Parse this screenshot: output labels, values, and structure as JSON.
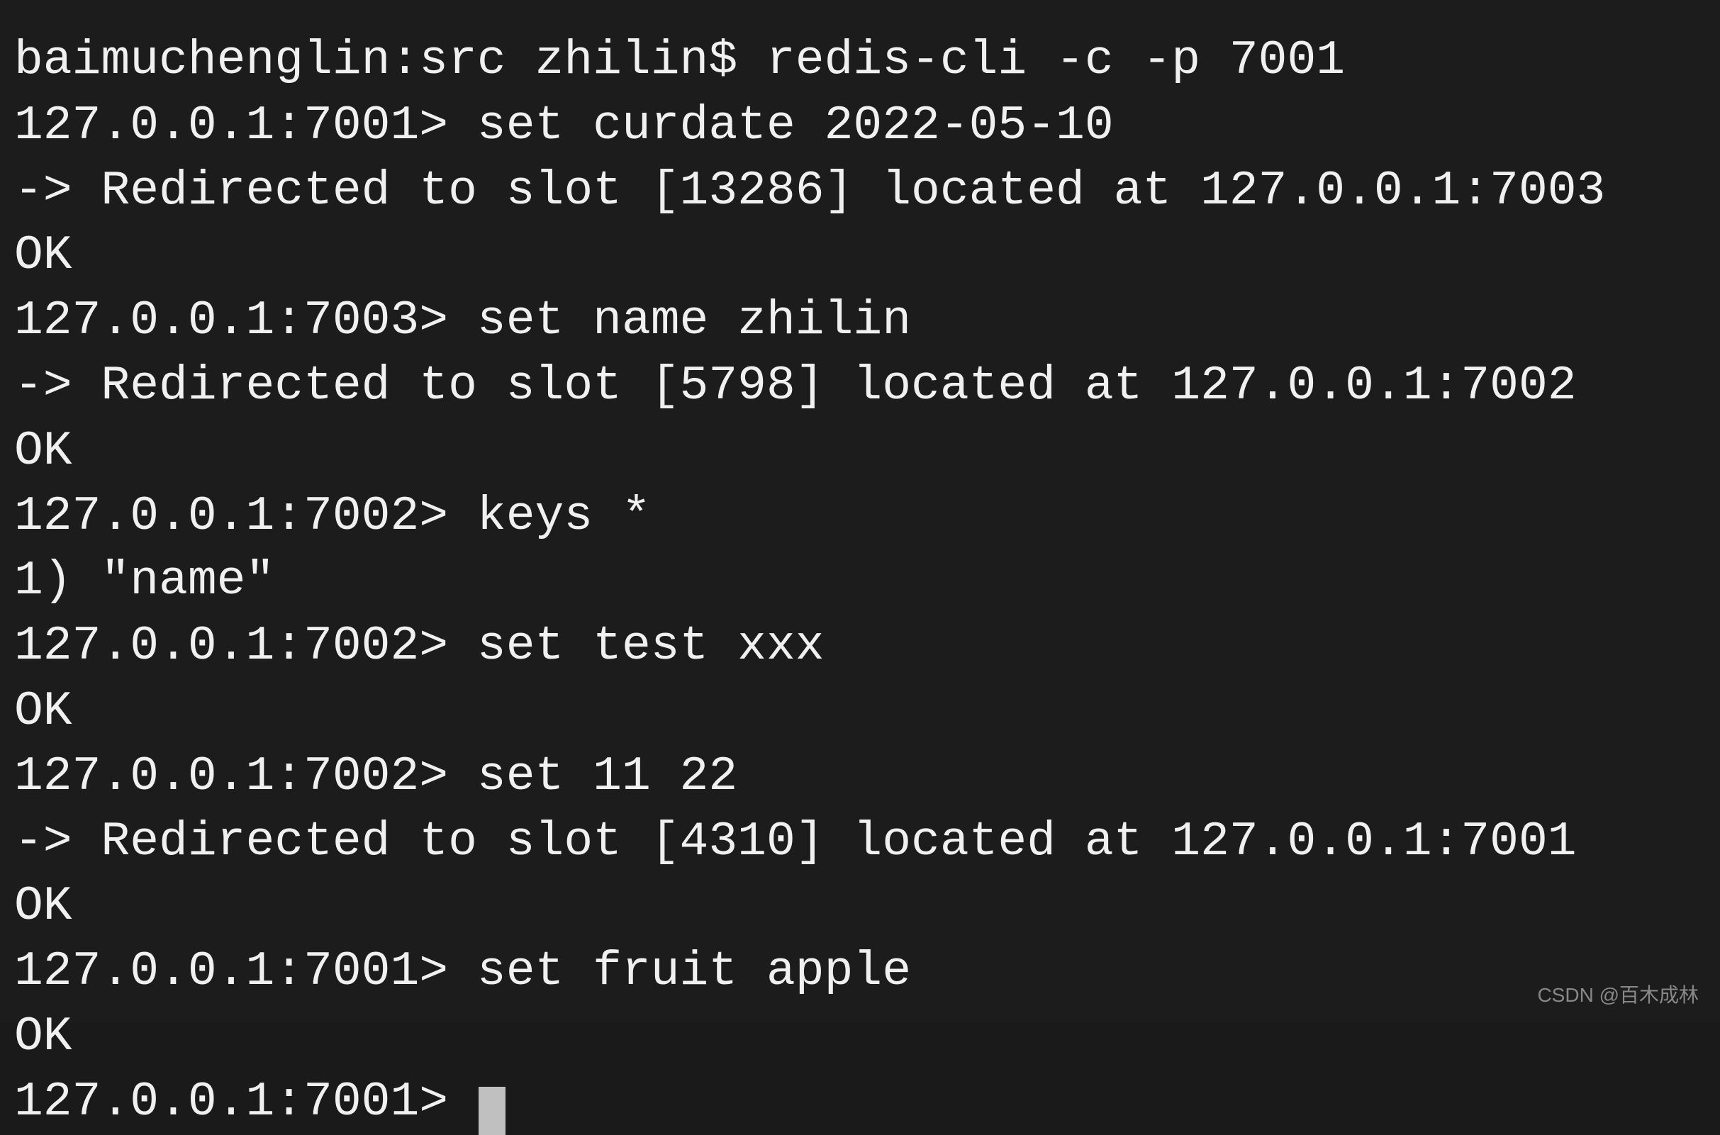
{
  "terminal": {
    "lines": [
      {
        "id": "line1",
        "text": "baimuchenglin:src zhilin$ redis-cli -c -p 7001",
        "type": "prompt"
      },
      {
        "id": "line2",
        "text": "127.0.0.1:7001> set curdate 2022-05-10",
        "type": "prompt"
      },
      {
        "id": "line3",
        "text": "-> Redirected to slot [13286] located at 127.0.0.1:7003",
        "type": "redirect"
      },
      {
        "id": "line4",
        "text": "OK",
        "type": "ok"
      },
      {
        "id": "line5",
        "text": "127.0.0.1:7003> set name zhilin",
        "type": "prompt"
      },
      {
        "id": "line6",
        "text": "-> Redirected to slot [5798] located at 127.0.0.1:7002",
        "type": "redirect"
      },
      {
        "id": "line7",
        "text": "OK",
        "type": "ok"
      },
      {
        "id": "line8",
        "text": "127.0.0.1:7002> keys *",
        "type": "prompt"
      },
      {
        "id": "line9",
        "text": "1) \"name\"",
        "type": "ok"
      },
      {
        "id": "line10",
        "text": "127.0.0.1:7002> set test xxx",
        "type": "prompt"
      },
      {
        "id": "line11",
        "text": "OK",
        "type": "ok"
      },
      {
        "id": "line12",
        "text": "127.0.0.1:7002> set 11 22",
        "type": "prompt"
      },
      {
        "id": "line13",
        "text": "-> Redirected to slot [4310] located at 127.0.0.1:7001",
        "type": "redirect"
      },
      {
        "id": "line14",
        "text": "OK",
        "type": "ok"
      },
      {
        "id": "line15",
        "text": "127.0.0.1:7001> set fruit apple",
        "type": "prompt"
      },
      {
        "id": "line16",
        "text": "OK",
        "type": "ok"
      },
      {
        "id": "line17",
        "text": "127.0.0.1:7001> ",
        "type": "prompt",
        "cursor": true
      }
    ]
  },
  "watermark": {
    "text": "CSDN @百木成林"
  }
}
